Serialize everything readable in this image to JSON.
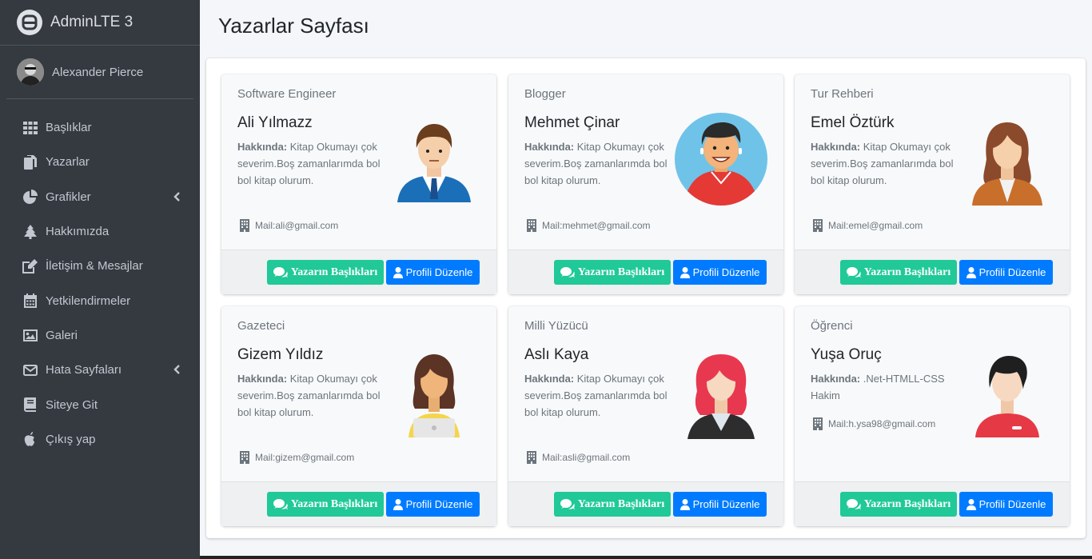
{
  "brand": {
    "name": "AdminLTE 3"
  },
  "user": {
    "name": "Alexander Pierce"
  },
  "sidebar": {
    "items": [
      {
        "label": "Başlıklar",
        "icon": "grid-icon"
      },
      {
        "label": "Yazarlar",
        "icon": "copy-icon"
      },
      {
        "label": "Grafikler",
        "icon": "pie-chart-icon",
        "has_children": true
      },
      {
        "label": "Hakkımızda",
        "icon": "tree-icon"
      },
      {
        "label": "İletişim & Mesajlar",
        "icon": "edit-icon"
      },
      {
        "label": "Yetkilendirmeler",
        "icon": "calendar-icon"
      },
      {
        "label": "Galeri",
        "icon": "image-icon"
      },
      {
        "label": "Hata Sayfaları",
        "icon": "envelope-icon",
        "has_children": true
      },
      {
        "label": "Siteye Git",
        "icon": "book-icon"
      },
      {
        "label": "Çıkış yap",
        "icon": "apple-icon"
      }
    ]
  },
  "page": {
    "title": "Yazarlar Sayfası"
  },
  "authors": [
    {
      "role": "Software Engineer",
      "name": "Ali Yılmazz",
      "about_label": "Hakkında:",
      "about": " Kitap Okumayı çok severim.Boş zamanlarımda bol bol kitap olurum.",
      "mail": "Mail:ali@gmail.com"
    },
    {
      "role": "Blogger",
      "name": "Mehmet Çinar",
      "about_label": "Hakkında:",
      "about": " Kitap Okumayı çok severim.Boş zamanlarımda bol bol kitap olurum.",
      "mail": "Mail:mehmet@gmail.com"
    },
    {
      "role": "Tur Rehberi",
      "name": "Emel Öztürk",
      "about_label": "Hakkında:",
      "about": " Kitap Okumayı çok severim.Boş zamanlarımda bol bol kitap olurum.",
      "mail": "Mail:emel@gmail.com"
    },
    {
      "role": "Gazeteci",
      "name": "Gizem Yıldız",
      "about_label": "Hakkında:",
      "about": " Kitap Okumayı çok severim.Boş zamanlarımda bol bol kitap olurum.",
      "mail": "Mail:gizem@gmail.com"
    },
    {
      "role": "Milli Yüzücü",
      "name": "Aslı Kaya",
      "about_label": "Hakkında:",
      "about": " Kitap Okumayı çok severim.Boş zamanlarımda bol bol kitap olurum.",
      "mail": "Mail:asli@gmail.com"
    },
    {
      "role": "Öğrenci",
      "name": "Yuşa Oruç",
      "about_label": "Hakkında:",
      "about": " .Net-HTMLL-CSS Hakim",
      "mail": "Mail:h.ysa98@gmail.com"
    }
  ],
  "buttons": {
    "titles": "Yazarın Başlıkları",
    "edit": "Profili Düzenle"
  },
  "colors": {
    "sidebar": "#343a40",
    "green_button": "#20c997",
    "blue_button": "#007bff",
    "background": "#f4f6f9"
  }
}
